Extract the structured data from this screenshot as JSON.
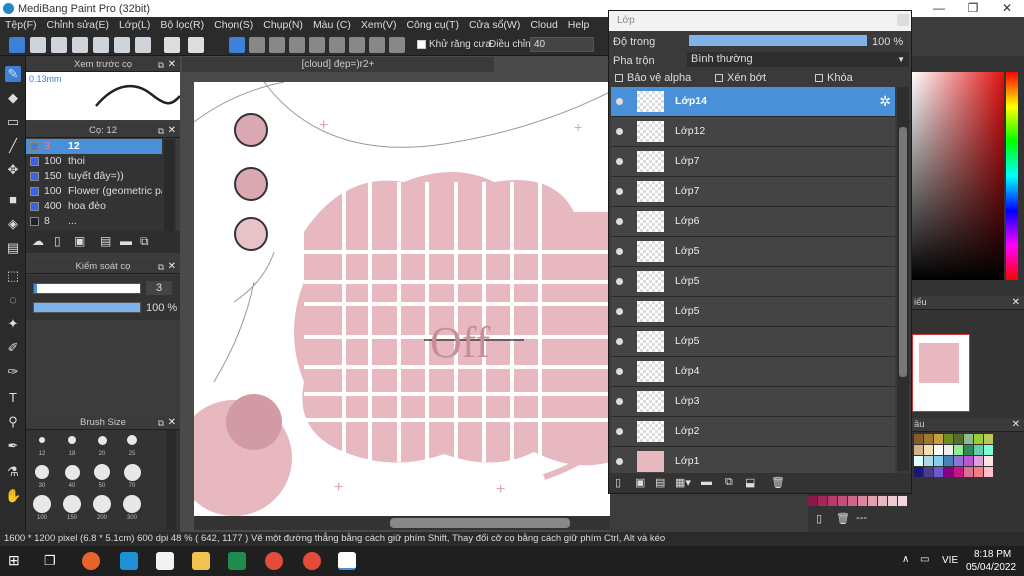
{
  "window": {
    "title": "MediBang Paint Pro (32bit)",
    "min": "—",
    "max": "❐",
    "close": "✕"
  },
  "menu": [
    "Tệp(F)",
    "Chỉnh sửa(E)",
    "Lớp(L)",
    "Bộ lọc(R)",
    "Chọn(S)",
    "Chụp(N)",
    "Màu (C)",
    "Xem(V)",
    "Công cụ(T)",
    "Cửa sổ(W)",
    "Cloud",
    "Help"
  ],
  "toolbar": {
    "antialias_label": "Khử răng cưa",
    "adjust_label": "Điều chỉnh",
    "adjust_value": "40"
  },
  "preview": {
    "title": "Xem trước cọ",
    "size": "0.13mm"
  },
  "brushes": {
    "title": "Cọ: 12",
    "items": [
      {
        "num": "3",
        "name": "12"
      },
      {
        "num": "100",
        "name": "thoi"
      },
      {
        "num": "150",
        "name": "tuyết đây=))"
      },
      {
        "num": "100",
        "name": "Flower (geometric patt"
      },
      {
        "num": "400",
        "name": "hoa đèo"
      },
      {
        "num": "8",
        "name": "..."
      }
    ]
  },
  "brush_control": {
    "title": "Kiểm soát cọ",
    "size": "3",
    "opacity": "100 %",
    "opacity_fraction": 1.0
  },
  "brush_size": {
    "title": "Brush Size",
    "sizes": [
      "12",
      "18",
      "20",
      "25",
      "30",
      "40",
      "50",
      "70",
      "100",
      "150",
      "200",
      "300"
    ]
  },
  "canvas": {
    "tab": "[cloud] đẹp=)r2+"
  },
  "layers": {
    "title": "Lớp",
    "opacity_label": "Độ trong",
    "opacity_value": "100 %",
    "blend_label": "Pha trộn",
    "blend_value": "Bình thường",
    "protect_alpha": "Bảo vệ alpha",
    "clip": "Xén bớt",
    "lock": "Khóa",
    "items": [
      "Lớp14",
      "Lớp12",
      "Lớp7",
      "Lớp7",
      "Lớp6",
      "Lớp5",
      "Lớp5",
      "Lớp5",
      "Lớp5",
      "Lớp4",
      "Lớp3",
      "Lớp2",
      "Lớp1"
    ]
  },
  "right": {
    "navigator_title": "iểu",
    "palette_title": "ầu",
    "palette_bottom": "---"
  },
  "status": {
    "text": "1600 * 1200 pixel  (6.8 * 5.1cm)  600 dpi  48 %  ( 642, 1177 )  Vẽ một đường thẳng bằng cách giữ phím Shift, Thay đổi cỡ cọ bằng cách giữ phím Ctrl, Alt và kéo"
  },
  "taskbar": {
    "lang": "VIE",
    "time": "8:18 PM",
    "date": "05/04/2022"
  },
  "colors": {
    "accent": "#4a90d9",
    "pink": "#e7b8bf"
  }
}
